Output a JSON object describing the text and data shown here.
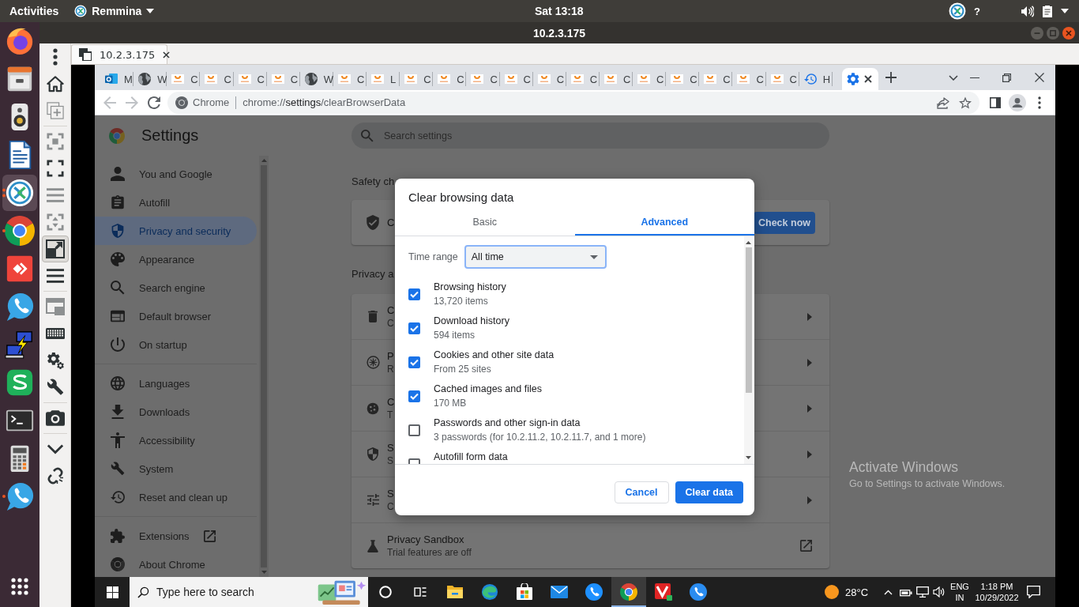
{
  "top_bar": {
    "activities": "Activities",
    "app_menu": "Remmina",
    "help": "?",
    "clock": "Sat 13:18"
  },
  "dock": {
    "apps": [
      {
        "selected": false,
        "running": false,
        "multi_window": false
      },
      {
        "selected": false,
        "running": false,
        "multi_window": false
      },
      {
        "selected": false,
        "running": false,
        "multi_window": false
      },
      {
        "selected": false,
        "running": false,
        "multi_window": false
      },
      {
        "selected": true,
        "running": true,
        "multi_window": true
      },
      {
        "selected": false,
        "running": true,
        "multi_window": false
      },
      {
        "selected": false,
        "running": false,
        "multi_window": false
      },
      {
        "selected": false,
        "running": false,
        "multi_window": false
      },
      {
        "selected": false,
        "running": false,
        "multi_window": false
      },
      {
        "selected": false,
        "running": false,
        "multi_window": false
      },
      {
        "selected": false,
        "running": false,
        "multi_window": false
      },
      {
        "selected": false,
        "running": false,
        "multi_window": false
      },
      {
        "selected": false,
        "running": true,
        "multi_window": false
      }
    ]
  },
  "remmina": {
    "title": "10.2.3.175",
    "tab": "10.2.3.175",
    "toolbar": [
      [
        {
          "selected": false,
          "disabled": false
        },
        {
          "selected": false,
          "disabled": false
        },
        {
          "selected": false,
          "disabled": true
        }
      ],
      [
        {
          "selected": false,
          "disabled": true
        },
        {
          "selected": false,
          "disabled": false
        },
        {
          "selected": false,
          "disabled": true
        },
        {
          "selected": false,
          "disabled": true
        },
        {
          "selected": true,
          "disabled": false
        },
        {
          "selected": false,
          "disabled": false
        }
      ],
      [
        {
          "selected": false,
          "disabled": true
        },
        {
          "selected": false,
          "disabled": false
        },
        {
          "selected": false,
          "disabled": false
        },
        {
          "selected": false,
          "disabled": false
        }
      ],
      [
        {
          "selected": false,
          "disabled": false
        }
      ],
      [
        {
          "selected": false,
          "disabled": false
        },
        {
          "selected": false,
          "disabled": false
        }
      ]
    ]
  },
  "browser": {
    "tabs": [
      {
        "title": "M",
        "selected": false
      },
      {
        "title": "W",
        "selected": false
      },
      {
        "title": "C",
        "selected": false
      },
      {
        "title": "C",
        "selected": false
      },
      {
        "title": "C",
        "selected": false
      },
      {
        "title": "C",
        "selected": false
      },
      {
        "title": "W",
        "selected": false
      },
      {
        "title": "C",
        "selected": false
      },
      {
        "title": "L",
        "selected": false
      },
      {
        "title": "C",
        "selected": false
      },
      {
        "title": "C",
        "selected": false
      },
      {
        "title": "C",
        "selected": false
      },
      {
        "title": "C",
        "selected": false
      },
      {
        "title": "C",
        "selected": false
      },
      {
        "title": "C",
        "selected": false
      },
      {
        "title": "C",
        "selected": false
      },
      {
        "title": "C",
        "selected": false
      },
      {
        "title": "C",
        "selected": false
      },
      {
        "title": "C",
        "selected": false
      },
      {
        "title": "C",
        "selected": false
      },
      {
        "title": "C",
        "selected": false
      },
      {
        "title": "H",
        "selected": false
      },
      {
        "selected": true
      }
    ],
    "back": {
      "disabled": true
    },
    "forward": {
      "disabled": true
    },
    "omnibox": {
      "chip": "Chrome",
      "url": {
        "scheme": "chrome://",
        "host": "settings",
        "path": "/clearBrowserData"
      }
    }
  },
  "settings": {
    "title": "Settings",
    "search_placeholder": "Search settings",
    "nav": [
      [
        {
          "label": "You and Google",
          "selected": false,
          "kind": "page"
        },
        {
          "label": "Autofill",
          "selected": false,
          "kind": "page"
        },
        {
          "label": "Privacy and security",
          "selected": true,
          "kind": "page"
        },
        {
          "label": "Appearance",
          "selected": false,
          "kind": "page"
        },
        {
          "label": "Search engine",
          "selected": false,
          "kind": "page"
        },
        {
          "label": "Default browser",
          "selected": false,
          "kind": "page"
        },
        {
          "label": "On startup",
          "selected": false,
          "kind": "page"
        }
      ],
      [
        {
          "label": "Languages",
          "selected": false,
          "kind": "page"
        },
        {
          "label": "Downloads",
          "selected": false,
          "kind": "page"
        },
        {
          "label": "Accessibility",
          "selected": false,
          "kind": "page"
        },
        {
          "label": "System",
          "selected": false,
          "kind": "page"
        },
        {
          "label": "Reset and clean up",
          "selected": false,
          "kind": "page"
        }
      ],
      [
        {
          "label": "Extensions",
          "selected": false,
          "kind": "external"
        },
        {
          "label": "About Chrome",
          "selected": false,
          "kind": "page"
        }
      ]
    ],
    "safety_check": {
      "heading": "Safety ch",
      "title": "C",
      "button": "Check now"
    },
    "privacy": {
      "heading": "Privacy a",
      "rows": [
        {
          "title": "C",
          "subtitle": "C",
          "kind": "subpage"
        },
        {
          "title": "P",
          "subtitle": "R",
          "kind": "subpage"
        },
        {
          "title": "C",
          "subtitle": "T",
          "kind": "subpage"
        },
        {
          "title": "S",
          "subtitle": "S",
          "kind": "subpage"
        },
        {
          "title": "S",
          "subtitle": "C",
          "kind": "subpage"
        },
        {
          "title": "Privacy Sandbox",
          "subtitle": "Trial features are off",
          "kind": "external"
        }
      ]
    }
  },
  "dialog": {
    "title": "Clear browsing data",
    "tabs": [
      {
        "label": "Basic",
        "selected": false
      },
      {
        "label": "Advanced",
        "selected": true
      }
    ],
    "time_range": {
      "label": "Time range",
      "value": "All time"
    },
    "items": [
      {
        "title": "Browsing history",
        "detail": "13,720 items",
        "checked": true
      },
      {
        "title": "Download history",
        "detail": "594 items",
        "checked": true
      },
      {
        "title": "Cookies and other site data",
        "detail": "From 25 sites",
        "checked": true
      },
      {
        "title": "Cached images and files",
        "detail": "170 MB",
        "checked": true
      },
      {
        "title": "Passwords and other sign-in data",
        "detail": "3 passwords (for 10.2.11.2, 10.2.11.7, and 1 more)",
        "checked": false
      },
      {
        "title": "Autofill form data",
        "checked": false
      }
    ],
    "buttons": [
      {
        "label": "Cancel",
        "kind": "secondary"
      },
      {
        "label": "Clear data",
        "kind": "primary"
      }
    ]
  },
  "activation_notice": {
    "title": "Activate Windows",
    "text": "Go to Settings to activate Windows."
  },
  "taskbar": {
    "search_placeholder": "Type here to search",
    "apps": [
      {
        "selected": false
      },
      {
        "selected": false
      },
      {
        "selected": false
      },
      {
        "selected": false
      },
      {
        "selected": false
      },
      {
        "selected": false
      },
      {
        "selected": false
      },
      {
        "selected": true
      },
      {
        "selected": false
      },
      {
        "selected": false
      }
    ],
    "weather": "28°C",
    "language": {
      "code": "ENG",
      "region": "IN"
    },
    "clock": {
      "time": "1:18 PM",
      "date": "10/29/2022"
    }
  }
}
